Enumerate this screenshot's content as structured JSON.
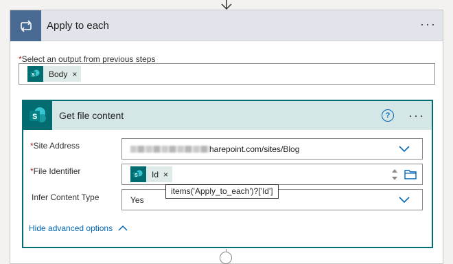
{
  "apply_each": {
    "title": "Apply to each",
    "more_label": "···",
    "select_output_label": "Select an output from previous steps",
    "required_marker": "*",
    "tokens": [
      {
        "label": "Body",
        "remove": "×"
      }
    ]
  },
  "get_file": {
    "title": "Get file content",
    "help": "?",
    "more_label": "···",
    "site_address": {
      "label": "Site Address",
      "value": "harepoint.com/sites/Blog"
    },
    "file_identifier": {
      "label": "File Identifier",
      "token_label": "Id",
      "token_remove": "×"
    },
    "infer_content_type": {
      "label": "Infer Content Type",
      "value": "Yes"
    },
    "advanced_link": "Hide advanced options",
    "tooltip": "items('Apply_to_each')?['Id']"
  },
  "colors": {
    "loop_tile": "#486991",
    "sharepoint": "#036c70",
    "header_band": "#e1e4ea",
    "inner_header_band": "#d4e7e6",
    "link": "#0067b8",
    "required": "#a4262c"
  },
  "icons": [
    "down-arrow-icon",
    "loop-icon",
    "sharepoint-icon",
    "remove-token-icon",
    "help-icon",
    "more-options-icon",
    "chevron-down-icon",
    "spin-updown-icon",
    "folder-icon",
    "chevron-up-icon",
    "add-step-icon"
  ]
}
